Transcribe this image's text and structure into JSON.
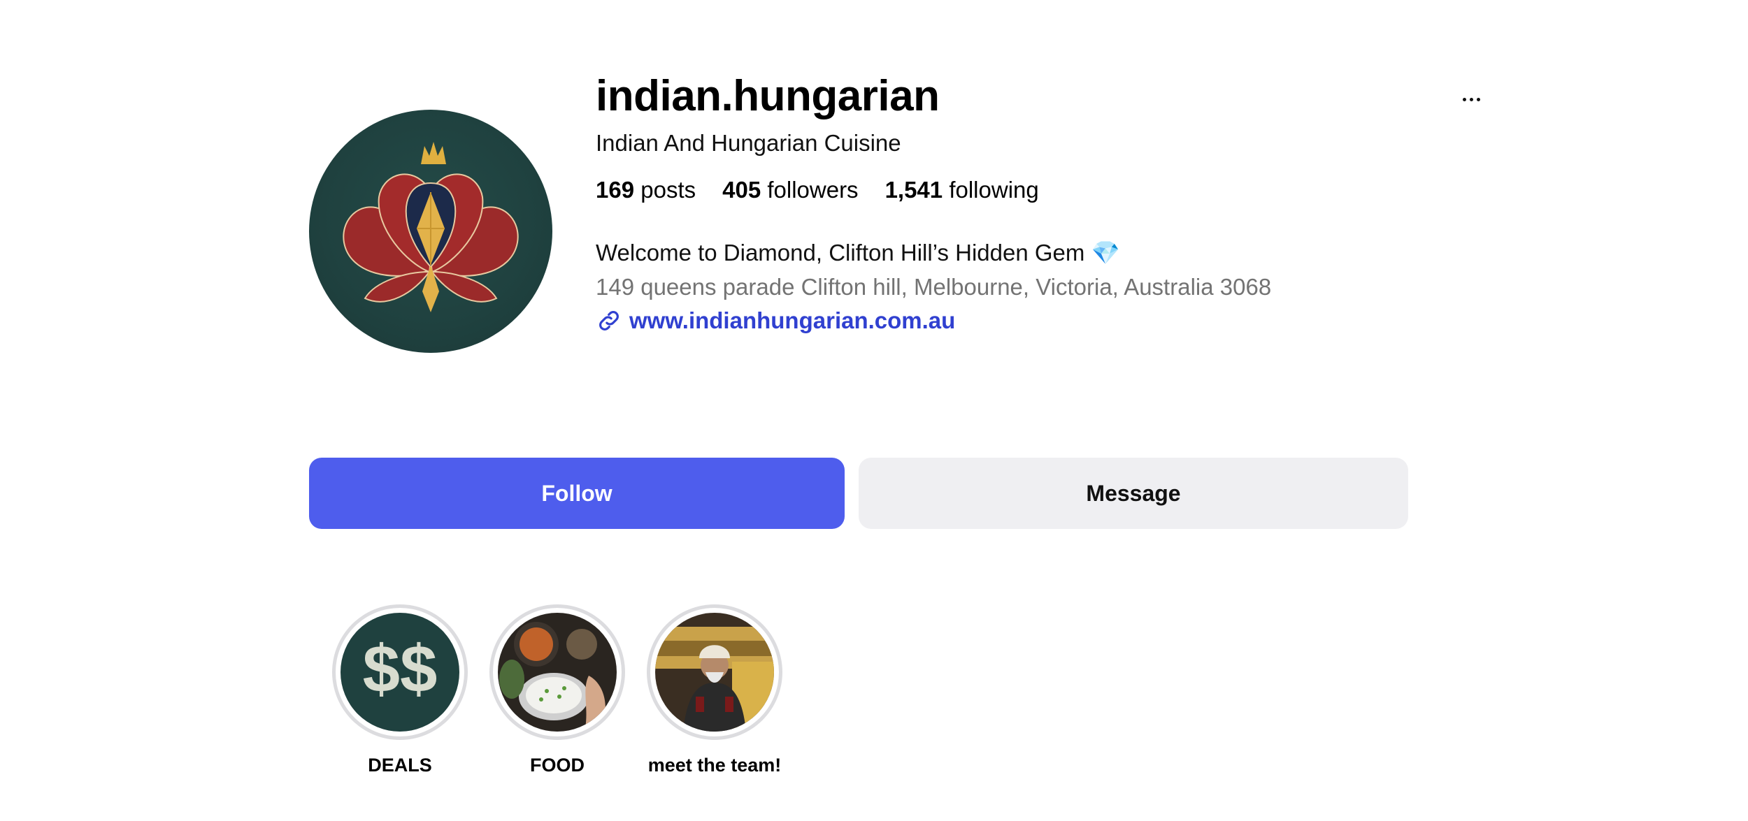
{
  "profile": {
    "username": "indian.hungarian",
    "category": "Indian And Hungarian Cuisine",
    "stats": {
      "posts_count": "169",
      "posts_label": "posts",
      "followers_count": "405",
      "followers_label": "followers",
      "following_count": "1,541",
      "following_label": "following"
    },
    "bio": "Welcome to Diamond, Clifton Hill’s Hidden Gem 💎",
    "address": "149 queens parade Clifton hill, Melbourne, Victoria, Australia 3068",
    "website": "www.indianhungarian.com.au",
    "avatar_icon": "lotus-diamond-logo"
  },
  "actions": {
    "follow_label": "Follow",
    "message_label": "Message"
  },
  "highlights": [
    {
      "label": "DEALS",
      "cover": "dollar-signs"
    },
    {
      "label": "FOOD",
      "cover": "food-dishes-photo"
    },
    {
      "label": "meet the team!",
      "cover": "team-member-photo"
    }
  ],
  "colors": {
    "follow_button": "#4e5ded",
    "message_button": "#efeff2",
    "link": "#3040d0",
    "secondary_text": "#737373",
    "avatar_background": "#1f413f"
  }
}
